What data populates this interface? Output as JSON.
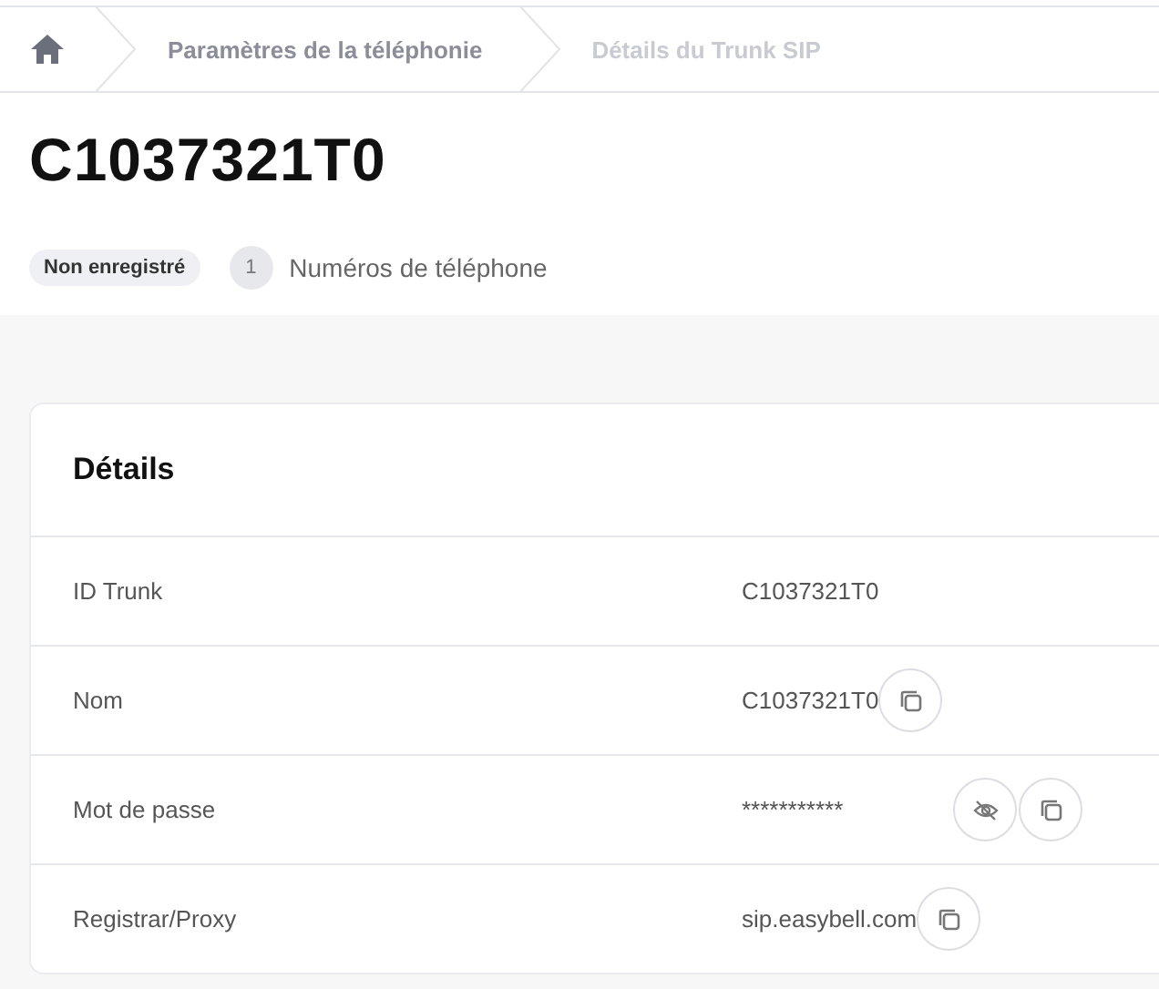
{
  "breadcrumb": [
    {
      "label": "Paramètres de la téléphonie",
      "selected": false
    },
    {
      "label": "Détails du Trunk SIP",
      "selected": true
    }
  ],
  "title": "C1037321T0",
  "status_badge": "Non enregistré",
  "phone_numbers": {
    "count": "1",
    "label": "Numéros de téléphone"
  },
  "details": {
    "title": "Détails",
    "rows": [
      {
        "label": "ID Trunk",
        "value": "C1037321T0",
        "kind": "plain"
      },
      {
        "label": "Nom",
        "value": "C1037321T0",
        "kind": "copy"
      },
      {
        "label": "Mot de passe",
        "value": "***********",
        "kind": "secret"
      },
      {
        "label": "Registrar/Proxy",
        "value": "sip.easybell.com",
        "kind": "copy"
      }
    ]
  }
}
